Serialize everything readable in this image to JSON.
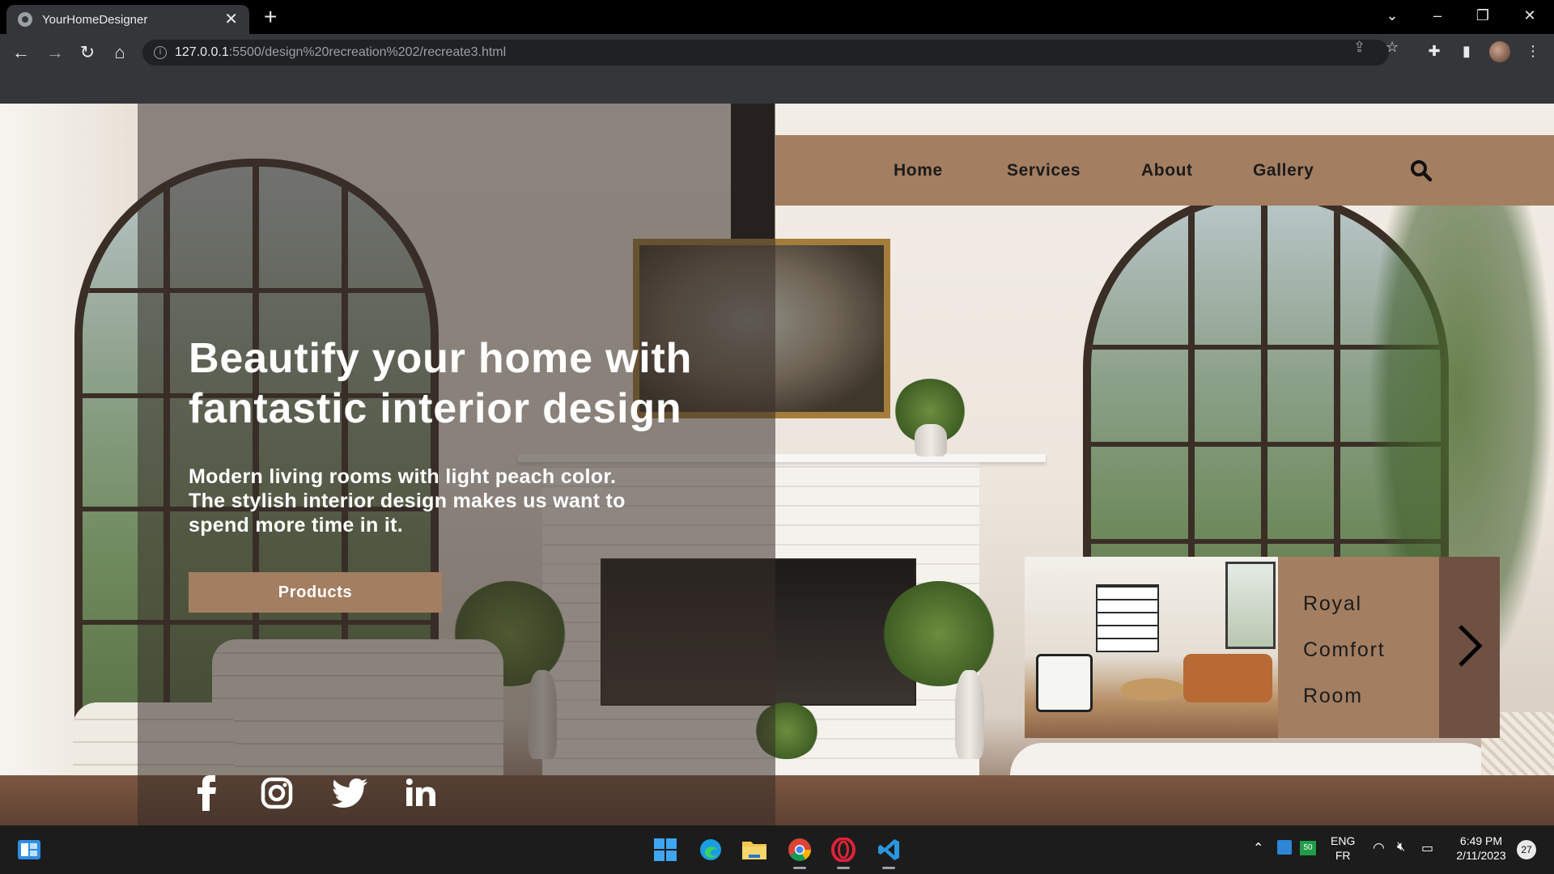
{
  "browser": {
    "tab_title": "YourHomeDesigner",
    "tab_close": "✕",
    "new_tab": "+",
    "url_host": "127.0.0.1",
    "url_rest": ":5500/design%20recreation%202/recreate3.html"
  },
  "nav": {
    "items": [
      "Home",
      "Services",
      "About",
      "Gallery"
    ]
  },
  "hero": {
    "title": "Beautify your home with fantastic interior design",
    "subtitle": "Modern living rooms with light peach color. The stylish interior design makes us want to spend more time in it.",
    "button": "Products"
  },
  "social": {
    "icons": [
      "facebook-icon",
      "instagram-icon",
      "twitter-icon",
      "linkedin-icon"
    ]
  },
  "card": {
    "lines": [
      "Royal",
      "Comfort",
      "Room"
    ]
  },
  "taskbar": {
    "lang_top": "ENG",
    "lang_bottom": "FR",
    "time": "6:49 PM",
    "date": "2/11/2023",
    "notification_count": "27",
    "battery_badge": "50"
  },
  "colors": {
    "accent": "#a37e61",
    "accent_dark": "#6e5142",
    "overlay": "rgba(55,45,40,0.55)"
  }
}
